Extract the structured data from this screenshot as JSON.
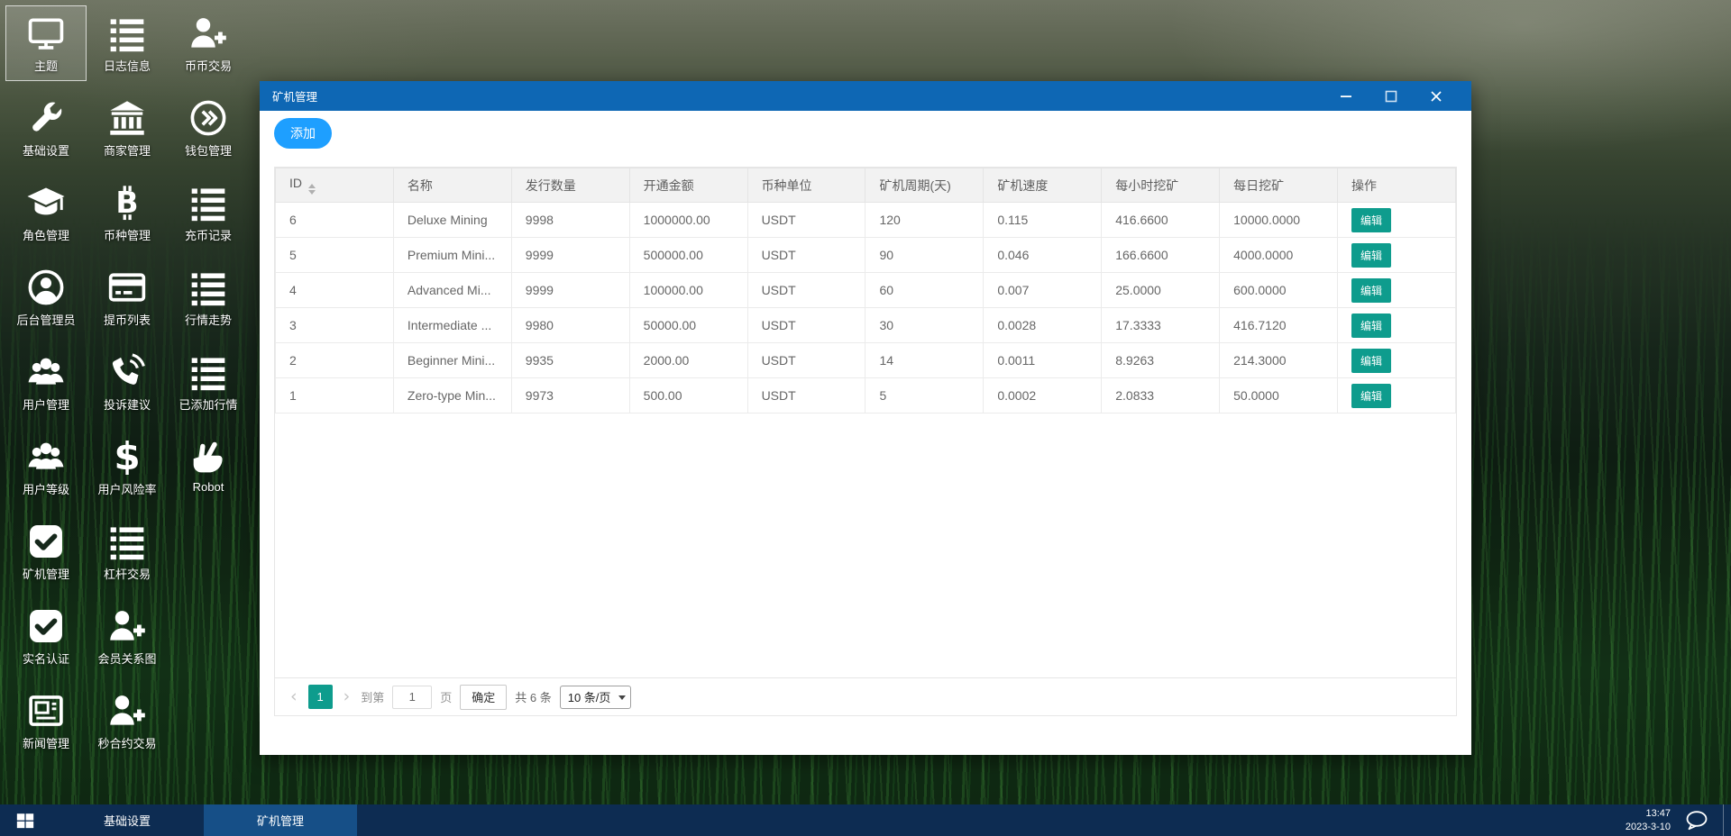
{
  "desktop": {
    "icon_rows": [
      [
        {
          "label": "主题",
          "icon": "monitor",
          "selected": true
        },
        {
          "label": "日志信息",
          "icon": "list"
        },
        {
          "label": "币币交易",
          "icon": "user-plus"
        }
      ],
      [
        {
          "label": "基础设置",
          "icon": "wrench"
        },
        {
          "label": "商家管理",
          "icon": "bank"
        },
        {
          "label": "钱包管理",
          "icon": "wallet"
        }
      ],
      [
        {
          "label": "角色管理",
          "icon": "graduation-cap"
        },
        {
          "label": "币种管理",
          "icon": "bitcoin"
        },
        {
          "label": "充币记录",
          "icon": "list"
        }
      ],
      [
        {
          "label": "后台管理员",
          "icon": "user-circle"
        },
        {
          "label": "提币列表",
          "icon": "credit-card"
        },
        {
          "label": "行情走势",
          "icon": "list"
        }
      ],
      [
        {
          "label": "用户管理",
          "icon": "users"
        },
        {
          "label": "投诉建议",
          "icon": "phone"
        },
        {
          "label": "已添加行情",
          "icon": "list"
        }
      ],
      [
        {
          "label": "用户等级",
          "icon": "users"
        },
        {
          "label": "用户风险率",
          "icon": "dollar"
        },
        {
          "label": "Robot",
          "icon": "hand"
        }
      ],
      [
        {
          "label": "矿机管理",
          "icon": "check-square"
        },
        {
          "label": "杠杆交易",
          "icon": "list"
        }
      ],
      [
        {
          "label": "实名认证",
          "icon": "check-square"
        },
        {
          "label": "会员关系图",
          "icon": "user-plus"
        }
      ],
      [
        {
          "label": "新闻管理",
          "icon": "newspaper"
        },
        {
          "label": "秒合约交易",
          "icon": "user-plus"
        }
      ]
    ]
  },
  "window": {
    "title": "矿机管理",
    "add_button": "添加",
    "table": {
      "columns": [
        "ID",
        "名称",
        "发行数量",
        "开通金额",
        "币种单位",
        "矿机周期(天)",
        "矿机速度",
        "每小时挖矿",
        "每日挖矿",
        "操作"
      ],
      "rows": [
        {
          "id": "6",
          "name": "Deluxe Mining",
          "issue": "9998",
          "open": "1000000.00",
          "unit": "USDT",
          "period": "120",
          "speed": "0.115",
          "hourly": "416.6600",
          "daily": "10000.0000",
          "action": "编辑"
        },
        {
          "id": "5",
          "name": "Premium Mini...",
          "issue": "9999",
          "open": "500000.00",
          "unit": "USDT",
          "period": "90",
          "speed": "0.046",
          "hourly": "166.6600",
          "daily": "4000.0000",
          "action": "编辑"
        },
        {
          "id": "4",
          "name": "Advanced Mi...",
          "issue": "9999",
          "open": "100000.00",
          "unit": "USDT",
          "period": "60",
          "speed": "0.007",
          "hourly": "25.0000",
          "daily": "600.0000",
          "action": "编辑"
        },
        {
          "id": "3",
          "name": "Intermediate ...",
          "issue": "9980",
          "open": "50000.00",
          "unit": "USDT",
          "period": "30",
          "speed": "0.0028",
          "hourly": "17.3333",
          "daily": "416.7120",
          "action": "编辑"
        },
        {
          "id": "2",
          "name": "Beginner Mini...",
          "issue": "9935",
          "open": "2000.00",
          "unit": "USDT",
          "period": "14",
          "speed": "0.0011",
          "hourly": "8.9263",
          "daily": "214.3000",
          "action": "编辑"
        },
        {
          "id": "1",
          "name": "Zero-type Min...",
          "issue": "9973",
          "open": "500.00",
          "unit": "USDT",
          "period": "5",
          "speed": "0.0002",
          "hourly": "2.0833",
          "daily": "50.0000",
          "action": "编辑"
        }
      ]
    },
    "pagination": {
      "prev": "‹",
      "next": "›",
      "page": "1",
      "goto_label": "到第",
      "page_input": "1",
      "page_suffix": "页",
      "confirm_label": "确定",
      "total_label": "共 6 条",
      "page_size": "10 条/页"
    }
  },
  "taskbar": {
    "tabs": [
      {
        "label": "基础设置",
        "active": false
      },
      {
        "label": "矿机管理",
        "active": true
      }
    ],
    "clock": {
      "time": "13:47",
      "date": "2023-3-10"
    }
  },
  "colors": {
    "titlebar": "#0e67b4",
    "accent_blue": "#1e9fff",
    "accent_teal": "#0e9c8d",
    "taskbar": "#0d2c52",
    "taskbar_active": "#164f87"
  }
}
